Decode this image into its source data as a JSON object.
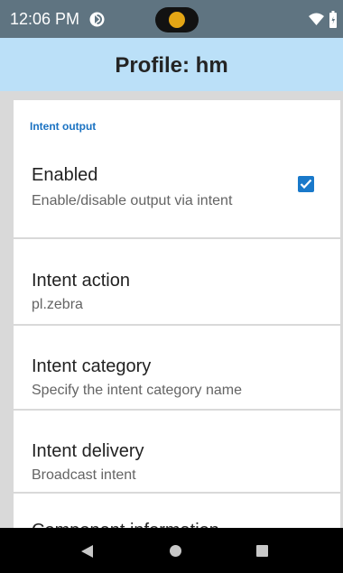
{
  "status_bar": {
    "time": "12:06 PM",
    "colors": {
      "background": "#5f7481",
      "pill_dot": "#e4a615"
    },
    "icons": [
      "sim-icon",
      "camera-pill",
      "wifi-icon",
      "battery-icon"
    ]
  },
  "app_bar": {
    "title": "Profile: hm",
    "background": "#bbe0f8"
  },
  "preferences": {
    "category": "Intent output",
    "items": [
      {
        "title": "Enabled",
        "summary": "Enable/disable output via intent",
        "checked": true
      },
      {
        "title": "Intent action",
        "summary": "pl.zebra"
      },
      {
        "title": "Intent category",
        "summary": "Specify the intent category name"
      },
      {
        "title": "Intent delivery",
        "summary": "Broadcast intent"
      },
      {
        "title": "Component information",
        "summary": ""
      }
    ],
    "accent": "#1979ca"
  },
  "nav_bar": {
    "icons": [
      "back-icon",
      "home-icon",
      "recent-apps-icon"
    ]
  }
}
